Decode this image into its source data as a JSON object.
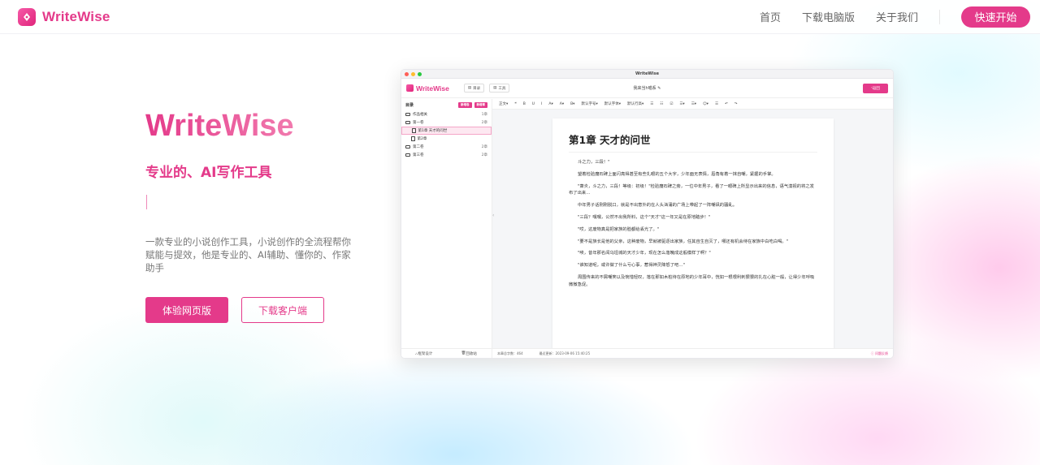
{
  "brand": {
    "name": "WriteWise",
    "accent": "#e43a8a"
  },
  "nav": {
    "links": [
      "首页",
      "下载电脑版",
      "关于我们"
    ],
    "cta_label": "快速开始"
  },
  "hero": {
    "title": "WriteWise",
    "subtitle": "专业的、AI写作工具",
    "description": "一款专业的小说创作工具，小说创作的全流程帮你赋能与提效，他是专业的、AI辅助、懂你的、作家助手",
    "primary_button": "体验网页版",
    "secondary_button": "下载客户端"
  },
  "app": {
    "window_title": "WriteWise",
    "logo_text": "WriteWise",
    "header_buttons": [
      "目录",
      "工具"
    ],
    "book_title": "我来当h喵系",
    "back_label": "返回",
    "sidebar": {
      "title": "目录",
      "tags": [
        "新增卷",
        "新增章"
      ],
      "tree": [
        {
          "label": "作品相关",
          "count": "1章",
          "type": "folder",
          "level": 0,
          "active": false
        },
        {
          "label": "第一卷",
          "count": "2章",
          "type": "folder",
          "level": 0,
          "active": false
        },
        {
          "label": "第1章 天才的问世",
          "count": "",
          "type": "file",
          "level": 1,
          "active": true
        },
        {
          "label": "第2章",
          "count": "",
          "type": "file",
          "level": 1,
          "active": false
        },
        {
          "label": "第二卷",
          "count": "2章",
          "type": "folder",
          "level": 0,
          "active": false
        },
        {
          "label": "第三卷",
          "count": "2章",
          "type": "folder",
          "level": 0,
          "active": false
        }
      ],
      "footer": [
        "框架设计",
        "回收站"
      ]
    },
    "toolbar": [
      "正文▾",
      "❝",
      "B",
      "U",
      "I",
      "A▾",
      "A▾",
      "B▾",
      "默认字号▾",
      "默认字体▾",
      "默认行高▾",
      "☰",
      "☷",
      "☑",
      "☰▾",
      "☰▾",
      "☺▾",
      "☰",
      "↶",
      "↷"
    ],
    "document": {
      "heading": "第1章  天才的问世",
      "paragraphs": [
        "斗之力，三段！\"",
        "望着检验魔石碑上面闪亮得甚至有些扎眼的五个大字，少年面无表情，唇角有着一抹自嘲，紧握的手掌。",
        "\"萧炎，斗之力，三段！等级：初级！\"检验魔石碑之旁，一位中年男子，看了一眼碑上所显示出来的信息，语气漠视的将之发布了出来…",
        "中年男子话刚刚脱口，就是不出意外的在人头汹涌的广场上带起了一阵嘲讽的骚乱。",
        "\"三段？嘿嘿，公然不出我所料，这个\"天才\"这一年又是在原地踏步！\"",
        "\"哎，这废物真是把家族的脸都给丢光了。\"",
        "\"要不是族长是他的父亲，这种废物，早就被驱逐出家族，任其自生自灭了，哪还有机会待在家族中白吃白喝。\"",
        "\"唉，昔年那名闻乌坦城的天才少年，现在怎么落魄成这般模样了啊？\"",
        "\"谁知道呢，或许做了什么亏心事，惹得神灵降怒了吧…\"",
        "周围传来的不屑嘲笑以及惋惜轻叹，落在那如木桩待在原地的少年耳中，恍如一根根利刺狠狠的扎在心脏一般，让得少年呼吸微微急促。"
      ]
    },
    "status": {
      "word_count": "本章总字数：464",
      "last_update": "最近更新：2023-09-06 15:40:25",
      "feedback": "问题反馈"
    }
  }
}
